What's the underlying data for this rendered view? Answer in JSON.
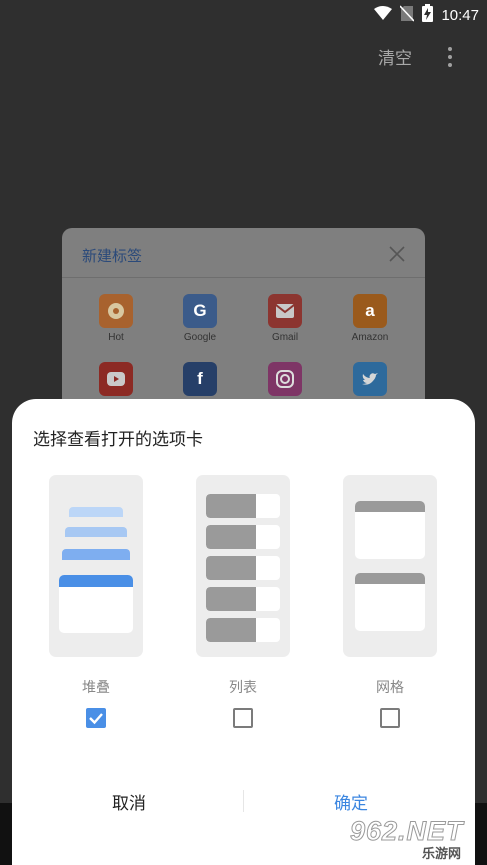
{
  "status_bar": {
    "time": "10:47",
    "icons": [
      "wifi-icon",
      "no-sim-icon",
      "battery-charging-icon"
    ]
  },
  "top_bar": {
    "clear_label": "清空",
    "more_icon": "more-vertical-icon"
  },
  "background_tab": {
    "title": "新建标签",
    "close_icon": "close-icon",
    "sites": [
      {
        "label": "Hot",
        "icon": "hot-icon",
        "color": "#e8743a"
      },
      {
        "label": "Google",
        "icon": "google-icon",
        "color": "#3f74c9"
      },
      {
        "label": "Gmail",
        "icon": "gmail-icon",
        "color": "#c9382f"
      },
      {
        "label": "Amazon",
        "icon": "amazon-icon",
        "color": "#e07b19"
      },
      {
        "label": "",
        "icon": "youtube-icon",
        "color": "#c8221c"
      },
      {
        "label": "",
        "icon": "facebook-icon",
        "color": "#2d4f8f"
      },
      {
        "label": "",
        "icon": "instagram-icon",
        "color": "#b53a8a"
      },
      {
        "label": "",
        "icon": "twitter-icon",
        "color": "#3a8fd6"
      }
    ]
  },
  "dialog": {
    "heading": "选择查看打开的选项卡",
    "options": [
      {
        "label": "堆叠",
        "checked": true
      },
      {
        "label": "列表",
        "checked": false
      },
      {
        "label": "网格",
        "checked": false
      }
    ],
    "cancel_label": "取消",
    "confirm_label": "确定",
    "accent": "#3b86e0"
  },
  "watermark": {
    "main_text": "962.NET",
    "sub_text": "乐游网"
  }
}
